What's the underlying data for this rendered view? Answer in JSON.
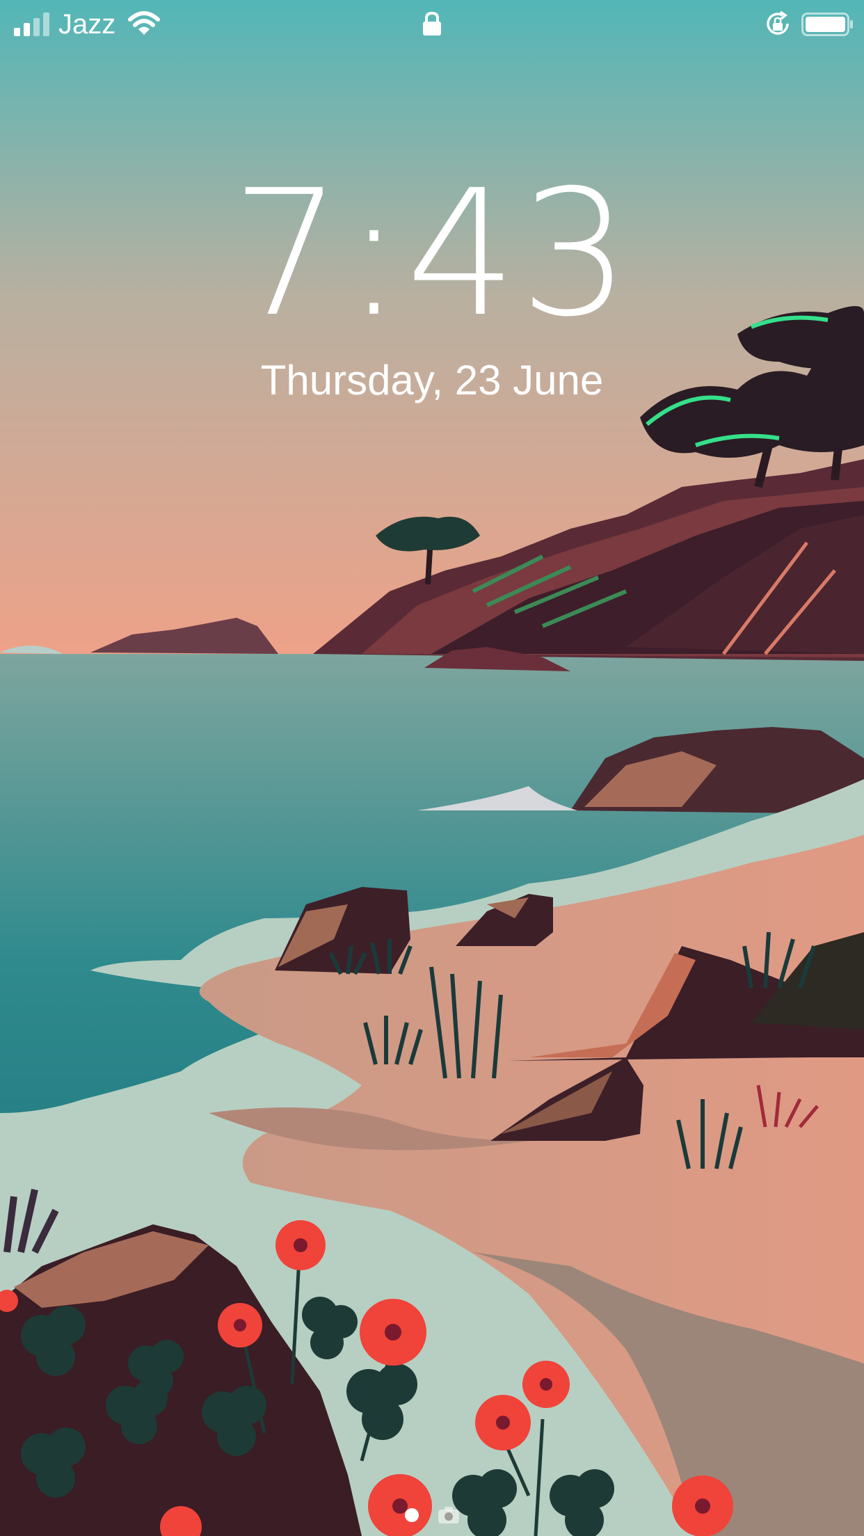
{
  "status_bar": {
    "carrier": "Jazz",
    "signal_icon": "signal-bars-icon",
    "wifi_icon": "wifi-icon",
    "lock_icon": "lock-icon",
    "rotation_lock_icon": "rotation-lock-icon",
    "battery_icon": "battery-icon"
  },
  "lockscreen": {
    "time": "7:43",
    "date": "Thursday, 23 June"
  },
  "bottom": {
    "page_indicator_icon": "page-dot-icon",
    "camera_icon": "camera-icon"
  },
  "colors": {
    "sky_top": "#52b6b7",
    "sky_bottom": "#e9a48d",
    "sea": "#1f7d84",
    "sand": "#c79785",
    "foam": "#b7cfc2"
  }
}
